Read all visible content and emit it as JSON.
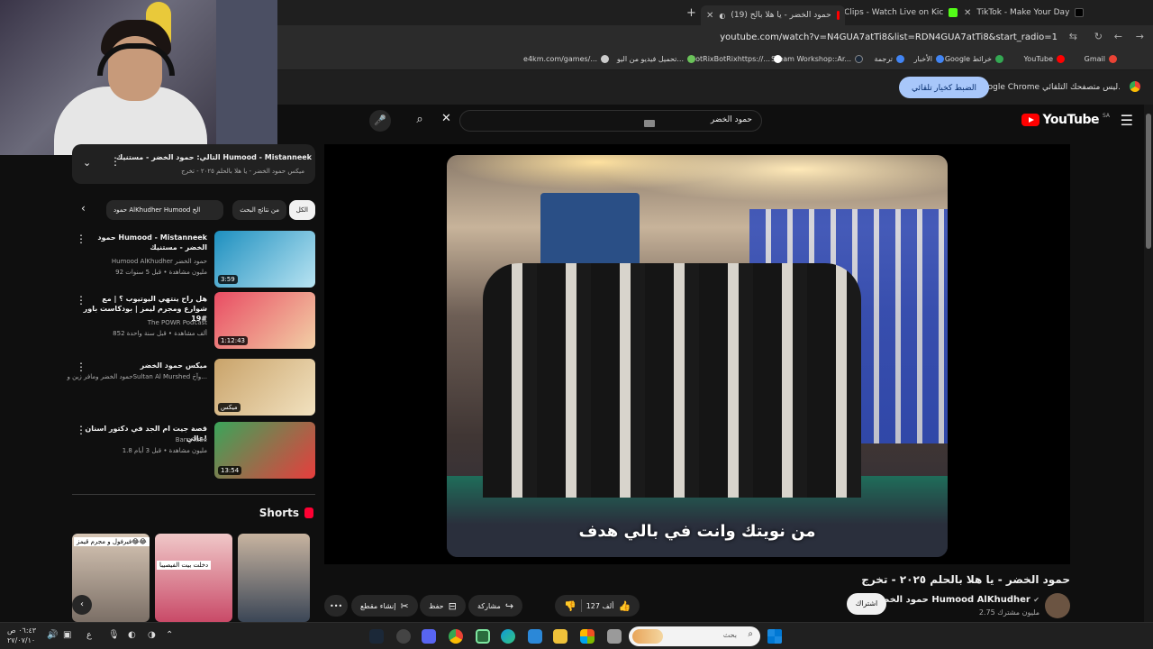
{
  "browser": {
    "tabs": [
      {
        "label": "TikTok - Make Your Day",
        "favicon_color": "#000000"
      },
      {
        "label": "Tsuki6 Clips - Watch Live on Kic",
        "favicon_color": "#53fc18"
      },
      {
        "label": "(19) حمود الخضر - يا هلا بالح",
        "favicon_color": "#ff0000"
      }
    ],
    "new_tab": "+",
    "url": "youtube.com/watch?v=N4GUA7atTi8&list=RDN4GUA7atTi8&start_radio=1",
    "bookmarks": [
      {
        "label": "Gmail",
        "color": "#ea4335"
      },
      {
        "label": "YouTube",
        "color": "#ff0000"
      },
      {
        "label": "Google خرائط",
        "color": "#34a853"
      },
      {
        "label": "الأخبار",
        "color": "#4285f4"
      },
      {
        "label": "ترجمة",
        "color": "#4285f4"
      },
      {
        "label": "Steam Workshop::Ar...",
        "color": "#1b2838"
      },
      {
        "label": "BotRixBotRixhttps://...",
        "color": "#ffffff"
      },
      {
        "label": "تحميل فيديو من اليو...",
        "color": "#6ac259"
      },
      {
        "label": "e4km.com/games/...",
        "color": "#cccccc"
      }
    ],
    "infobar": {
      "text": "Google Chrome ليس متصفحك التلقائي.",
      "button": "الضبط كخيار تلقائي"
    }
  },
  "youtube": {
    "logo_text": "YouTube",
    "region": "SA",
    "search_value": "حمود الخضر",
    "video": {
      "caption": "من نويتك وانت في بالي هدف",
      "title": "حمود الخضر - يا هلا بالحلم ٢٠٢٥ - تخرج",
      "channel": "حمود الخضر Humood AlKhudher",
      "subs": "2.75 مليون مشترك",
      "subscribe": "اشتراك",
      "likes": "127 ألف",
      "share": "مشاركة",
      "save": "حفظ",
      "clip": "إنشاء مقطع",
      "more": "•••"
    },
    "playlist": {
      "now": "التالي: حمود الخضر - مستنيك Humood - Mistanneek",
      "sub": "ميكس حمود الخضر - يا هلا بالحلم ٢٠٢٥ - تخرج"
    },
    "chips": [
      "الكل",
      "من نتائج البحث",
      "حمود AlKhudher Humood الخ"
    ],
    "recs": [
      {
        "title": "حمود Humood - Mistanneek الخضر - مستنيك",
        "channel": "Humood AlKhudher حمود الخضر",
        "meta": "92 مليون مشاهدة • قبل 5 سنوات",
        "duration": "3:59",
        "c1": "#1d8fbf",
        "c2": "#b9e4f2"
      },
      {
        "title": "هل راح ينتهي اليوتيوب ؟ | مع شوارع ومجرم ليمز | بودكاست باور #19",
        "channel": "The POWR Podcast",
        "meta": "852 ألف مشاهدة • قبل سنة واحدة",
        "duration": "1:12:43",
        "c1": "#e94c63",
        "c2": "#f2d0a6"
      },
      {
        "title": "ميكس حمود الخضر",
        "channel": "حمود الخضر ومافر زين وSultan Al Murshed وآخ...",
        "meta": "",
        "duration": "ميكس",
        "c1": "#c9a36a",
        "c2": "#f2e2c0"
      },
      {
        "title": "قصة جيت ام الجد في دكتور اسنان عالي!",
        "channel": "BarryTube",
        "meta": "1.8 مليون مشاهدة • قبل 3 أيام",
        "duration": "13:54",
        "c1": "#3aa55a",
        "c2": "#e83d3d"
      }
    ],
    "shorts_title": "Shorts",
    "shorts": [
      {
        "cap": "فيرفول و مجرم قيمز😂😂",
        "c1": "#7b6f66",
        "c2": "#d7c6b5"
      },
      {
        "cap": "دخلت بيت الفيصيبا",
        "c1": "#c94a68",
        "c2": "#f0c8c8"
      },
      {
        "cap": "",
        "c1": "#3b4656",
        "c2": "#c8b4a0"
      }
    ]
  },
  "taskbar": {
    "search": "بحث",
    "time": "٠٦:٤٣ ص",
    "date": "٢٧/٠٧/١٠",
    "lang": "ع"
  }
}
